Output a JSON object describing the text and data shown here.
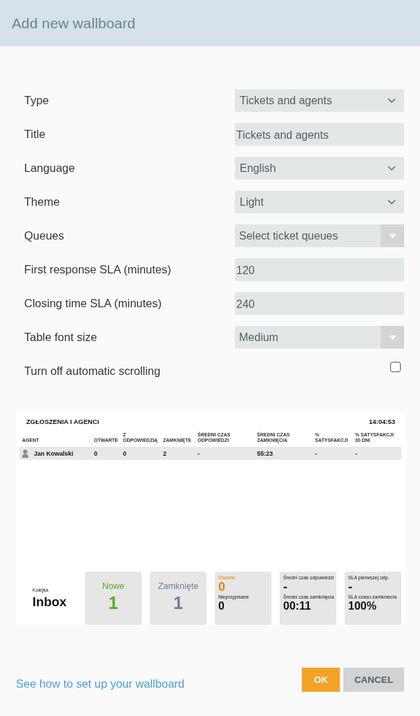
{
  "dialog": {
    "title": "Add new wallboard"
  },
  "form": {
    "fields": [
      {
        "kind": "select",
        "label": "Type",
        "value": "Tickets and agents"
      },
      {
        "kind": "input",
        "label": "Title",
        "value": "Tickets and agents"
      },
      {
        "kind": "select",
        "label": "Language",
        "value": "English"
      },
      {
        "kind": "select",
        "label": "Theme",
        "value": "Light"
      },
      {
        "kind": "combo",
        "label": "Queues",
        "placeholder": "Select ticket queues"
      },
      {
        "kind": "input",
        "label": "First response SLA (minutes)",
        "value": "120"
      },
      {
        "kind": "input",
        "label": "Closing time SLA (minutes)",
        "value": "240"
      },
      {
        "kind": "combo",
        "label": "Table font size",
        "value": "Medium"
      },
      {
        "kind": "checkbox",
        "label": "Turn off automatic scrolling",
        "checked": false
      }
    ]
  },
  "preview": {
    "title": "ZGŁOSZENIA I AGENCI",
    "time": "14:04:53",
    "columns": [
      "AGENT",
      "OTWARTE",
      "Z ODPOWIEDZIĄ",
      "ZAMKNIĘTE",
      "ŚREDNI CZAS ODPOWIEDZI",
      "ŚREDNI CZAS ZAMKNIĘCIA",
      "% SATYSFAKCJI",
      "% SATYSFAKCJI 30 DNI"
    ],
    "rows": [
      {
        "agent": "Jan Kowalski",
        "values": [
          "0",
          "0",
          "2",
          "-",
          "55:23",
          "-",
          "-"
        ]
      }
    ],
    "queue": {
      "label": "Kolejka",
      "name": "Inbox"
    },
    "cards": [
      {
        "kind": "total",
        "label": "Nowe",
        "value": "1",
        "color": "#5aab1e"
      },
      {
        "kind": "total",
        "label": "Zamknięte",
        "value": "1",
        "color": "#6e7e98"
      },
      {
        "kind": "pair",
        "stats": [
          {
            "label": "Otwarte",
            "value": "0",
            "color": "#f07f0a"
          },
          {
            "label": "Nieprzypisane",
            "value": "0",
            "color": "#111111"
          }
        ]
      },
      {
        "kind": "pair",
        "stats": [
          {
            "label": "Średni czas odpowiedzi",
            "value": "-",
            "color": "#111111"
          },
          {
            "label": "Średni czas zamknięcia",
            "value": "00:11",
            "color": "#111111"
          }
        ]
      },
      {
        "kind": "pair",
        "stats": [
          {
            "label": "SLA pierwszej odp.",
            "value": "-",
            "color": "#111111"
          },
          {
            "label": "SLA czasu zamkniecia",
            "value": "100%",
            "color": "#111111"
          }
        ]
      }
    ]
  },
  "footer": {
    "help_link": "See how to set up your wallboard",
    "buttons": [
      {
        "kind": "primary",
        "label": "OK"
      },
      {
        "kind": "secondary",
        "label": "CANCEL"
      }
    ]
  }
}
